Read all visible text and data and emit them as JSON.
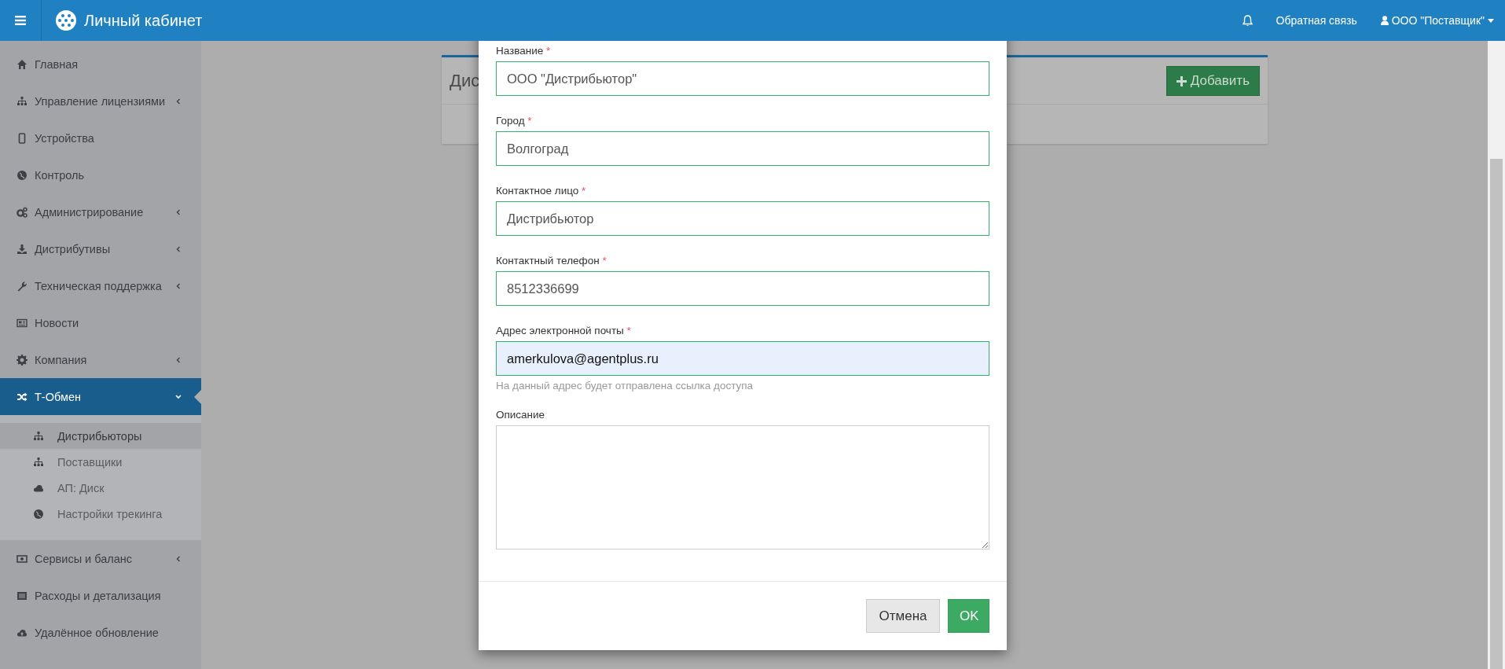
{
  "header": {
    "title": "Личный кабинет",
    "feedback": "Обратная связь",
    "user": "ООО \"Поставщик\""
  },
  "sidebar": {
    "items": [
      {
        "label": "Главная",
        "selected": false
      },
      {
        "label": "Управление лицензиями",
        "selected": false,
        "expanded": false
      },
      {
        "label": "Устройства",
        "selected": false
      },
      {
        "label": "Контроль",
        "selected": false
      },
      {
        "label": "Администрирование",
        "selected": false,
        "expanded": false
      },
      {
        "label": "Дистрибутивы",
        "selected": false,
        "expanded": false
      },
      {
        "label": "Техническая поддержка",
        "selected": false,
        "expanded": false
      },
      {
        "label": "Новости",
        "selected": false
      },
      {
        "label": "Компания",
        "selected": false,
        "expanded": false
      },
      {
        "label": "Т-Обмен",
        "selected": true,
        "expanded": true,
        "children": [
          {
            "label": "Дистрибьюторы",
            "selected": true
          },
          {
            "label": "Поставщики",
            "selected": false
          },
          {
            "label": "АП: Диск",
            "selected": false
          },
          {
            "label": "Настройки трекинга",
            "selected": false
          }
        ]
      },
      {
        "label": "Сервисы и баланс",
        "selected": false,
        "expanded": false
      },
      {
        "label": "Расходы и детализация",
        "selected": false
      },
      {
        "label": "Удалённое обновление",
        "selected": false
      }
    ]
  },
  "card": {
    "title": "Дис",
    "add_button": "Добавить"
  },
  "dialog": {
    "fields": [
      {
        "kind": "input",
        "label": "Название",
        "required_mark": "*",
        "value": "ООО \"Дистрибьютор\"",
        "focused": false
      },
      {
        "kind": "input",
        "label": "Город",
        "required_mark": "*",
        "value": "Волгоград",
        "focused": false
      },
      {
        "kind": "input",
        "label": "Контактное лицо",
        "required_mark": "*",
        "value": "Дистрибьютор",
        "focused": false
      },
      {
        "kind": "input",
        "label": "Контактный телефон",
        "required_mark": "*",
        "value": "8512336699",
        "focused": false
      },
      {
        "kind": "input",
        "label": "Адрес электронной почты",
        "required_mark": "*",
        "value": "amerkulova@agentplus.ru",
        "focused": true,
        "help": "На данный адрес будет отправлена ссылка доступа"
      },
      {
        "kind": "textarea",
        "label": "Описание"
      }
    ],
    "buttons": [
      {
        "kind": "cancel",
        "label": "Отмена"
      },
      {
        "kind": "ok",
        "label": "OK"
      }
    ]
  }
}
